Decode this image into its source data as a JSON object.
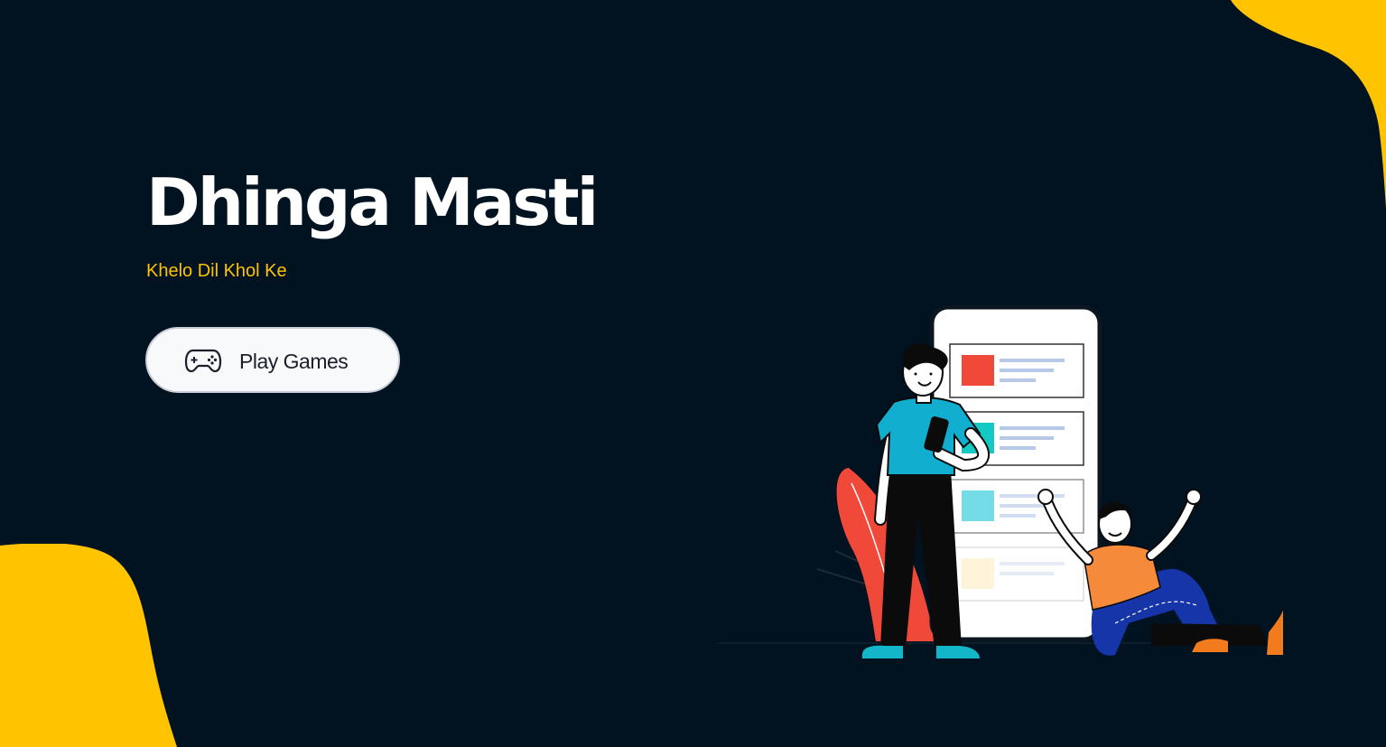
{
  "hero": {
    "title": "Dhinga Masti",
    "tagline": "Khelo Dil Khol Ke"
  },
  "cta": {
    "play_label": "Play Games",
    "icon": "gamepad-icon"
  },
  "colors": {
    "background": "#011220",
    "accent": "#ffc300",
    "button_bg": "#f8f9fb",
    "title": "#ffffff"
  },
  "illustration": {
    "icon": "people-with-phone-illustration"
  }
}
